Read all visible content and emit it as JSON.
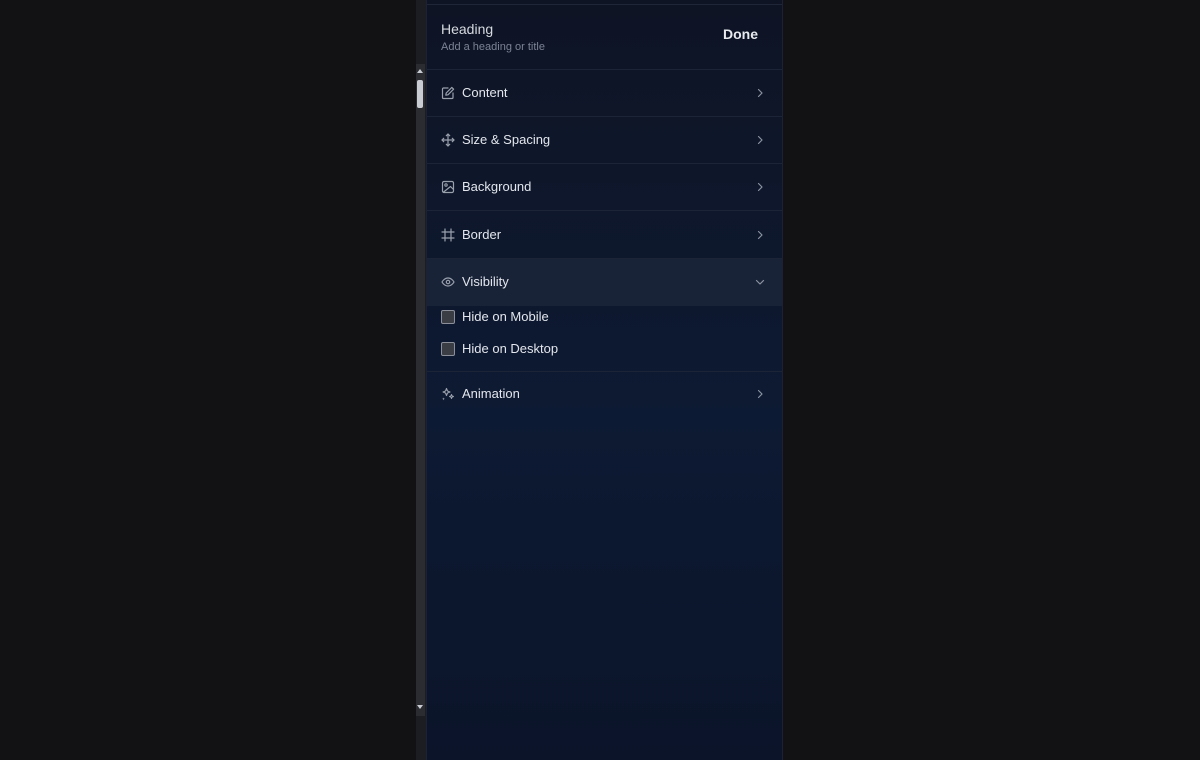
{
  "header": {
    "title": "Heading",
    "subtitle": "Add a heading or title",
    "done_label": "Done"
  },
  "sections": [
    {
      "label": "Content",
      "icon": "edit-icon",
      "expanded": false
    },
    {
      "label": "Size & Spacing",
      "icon": "move-icon",
      "expanded": false
    },
    {
      "label": "Background",
      "icon": "image-icon",
      "expanded": false
    },
    {
      "label": "Border",
      "icon": "frame-icon",
      "expanded": false
    },
    {
      "label": "Visibility",
      "icon": "eye-icon",
      "expanded": true
    },
    {
      "label": "Animation",
      "icon": "sparkles-icon",
      "expanded": false
    }
  ],
  "visibility": {
    "options": [
      {
        "label": "Hide on Mobile",
        "checked": false
      },
      {
        "label": "Hide on Desktop",
        "checked": false
      }
    ]
  },
  "colors": {
    "page_background": "#121214",
    "panel_background": "#0d1a33",
    "active_row": "#182338",
    "text_primary": "#e3e6ec",
    "text_muted": "#7c8394"
  }
}
